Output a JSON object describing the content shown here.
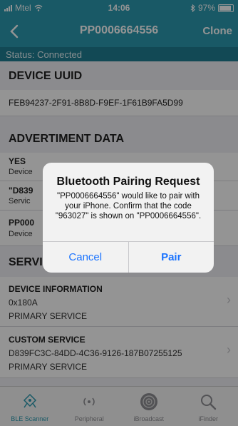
{
  "status_bar": {
    "carrier": "Mtel",
    "time": "14:06",
    "battery": "97%"
  },
  "nav": {
    "title": "PP0006664556",
    "right_button": "Clone"
  },
  "connection_status": "Status: Connected",
  "sections": {
    "uuid_header": "DEVICE UUID",
    "uuid_value": "FEB94237-2F91-8B8D-F9EF-1F61B9FA5D99",
    "adv_header": "ADVERTIMENT DATA",
    "adv_items": [
      {
        "title": "YES",
        "subtitle": "Device"
      },
      {
        "title": "\"D839",
        "subtitle": "Servic"
      },
      {
        "title": "PP000",
        "subtitle": "Device"
      }
    ],
    "services_header": "SERVICES",
    "services": [
      {
        "name": "DEVICE INFORMATION",
        "uuid": "0x180A",
        "type": "PRIMARY SERVICE"
      },
      {
        "name": "CUSTOM SERVICE",
        "uuid": "D839FC3C-84DD-4C36-9126-187B07255125",
        "type": "PRIMARY SERVICE"
      }
    ]
  },
  "alert": {
    "title": "Bluetooth Pairing Request",
    "message": "\"PP0006664556\" would like to pair with your iPhone. Confirm that the code \"963027\" is shown on \"PP0006664556\".",
    "cancel": "Cancel",
    "confirm": "Pair"
  },
  "tabs": [
    {
      "label": "BLE Scanner",
      "icon": "ble-scanner-icon"
    },
    {
      "label": "Peripheral",
      "icon": "peripheral-icon"
    },
    {
      "label": "iBroadcast",
      "icon": "broadcast-icon"
    },
    {
      "label": "iFinder",
      "icon": "search-icon"
    }
  ],
  "colors": {
    "header": "#2b9ab0",
    "status_strip": "#1f7f93",
    "accent_blue": "#1a73ff"
  }
}
